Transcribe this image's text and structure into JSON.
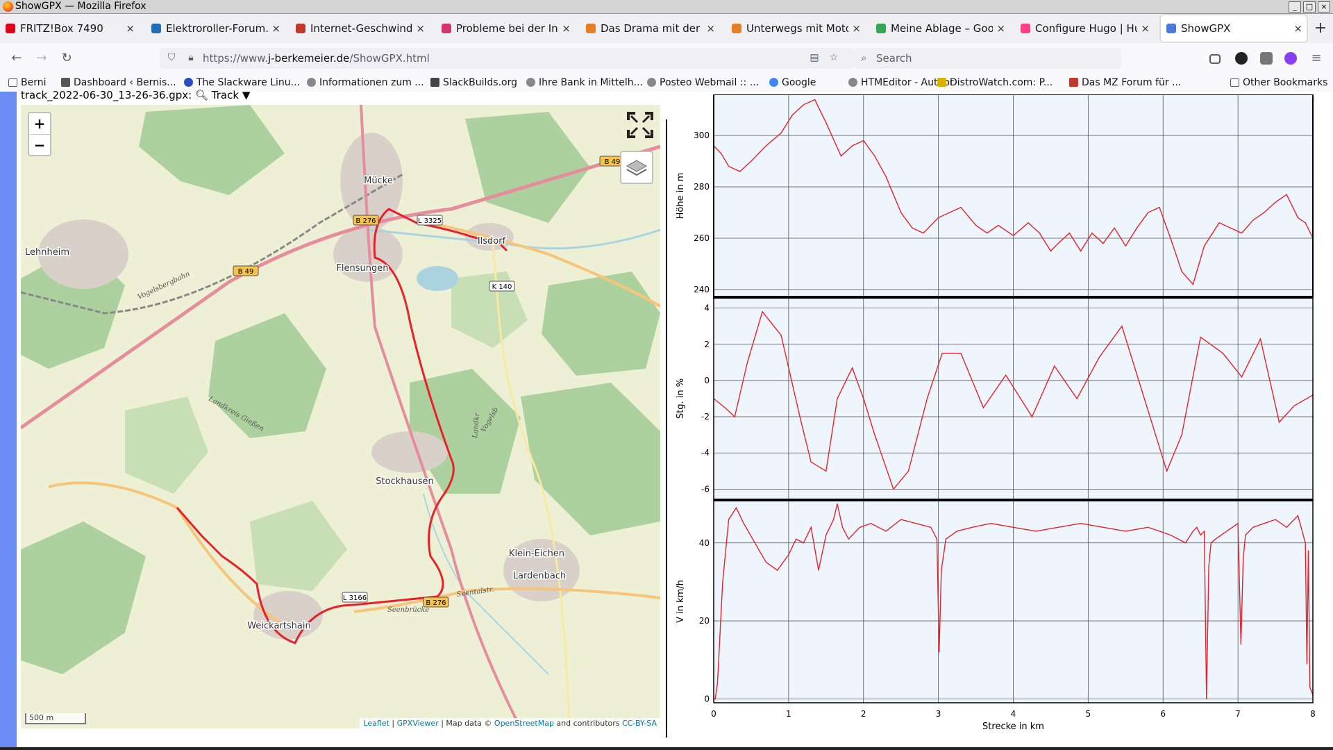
{
  "window": {
    "title": "ShowGPX — Mozilla Firefox"
  },
  "tabs": [
    {
      "label": "FRITZ!Box 7490",
      "color": "#e2001a"
    },
    {
      "label": "Elektroroller-Forum.de",
      "color": "#1e6fb8"
    },
    {
      "label": "Internet-Geschwindigk",
      "color": "#c0392b"
    },
    {
      "label": "Probleme bei der Insta",
      "color": "#d6336c"
    },
    {
      "label": "Das Drama mit der Ap",
      "color": "#e67e22"
    },
    {
      "label": "Unterwegs mit Motorr",
      "color": "#e67e22"
    },
    {
      "label": "Meine Ablage – Google",
      "color": "#34a853"
    },
    {
      "label": "Configure Hugo | Hugo",
      "color": "#ff4088"
    },
    {
      "label": "ShowGPX",
      "color": "#4a7bd9"
    }
  ],
  "nav": {
    "url_prefix": "https://www.",
    "url_domain": "j-berkemeier.de",
    "url_path": "/ShowGPX.html",
    "search_placeholder": "Search"
  },
  "bookmarks": [
    {
      "label": "Berni",
      "icon": "folder-icon"
    },
    {
      "label": "Dashboard ‹ Bernis...",
      "icon": "page-icon"
    },
    {
      "label": "The Slackware Linu...",
      "icon": "slackware-icon"
    },
    {
      "label": "Informationen zum ...",
      "icon": "globe-icon"
    },
    {
      "label": "SlackBuilds.org",
      "icon": "slackbuilds-icon"
    },
    {
      "label": "Ihre Bank in Mittelh...",
      "icon": "globe-icon"
    },
    {
      "label": "Posteo Webmail :: ...",
      "icon": "globe-icon"
    },
    {
      "label": "Google",
      "icon": "google-icon"
    },
    {
      "label": "HTMEditor - Author",
      "icon": "globe-icon"
    },
    {
      "label": "DistroWatch.com: P...",
      "icon": "distrowatch-icon"
    },
    {
      "label": "Das MZ Forum für ...",
      "icon": "mz-icon"
    },
    {
      "label": "Other Bookmarks",
      "icon": "folder-icon"
    }
  ],
  "track": {
    "file": "track_2022-06-30_13-26-36.gpx:",
    "menu_label": "Track ▼"
  },
  "map": {
    "zoom_in": "+",
    "zoom_out": "−",
    "scale": "500 m",
    "attribution": {
      "leaflet": "Leaflet",
      "sep1": " | ",
      "gpxviewer": "GPXViewer",
      "mapdata": " | Map data © ",
      "osm": "OpenStreetMap",
      "contrib": " and contributors ",
      "license": "CC-BY-SA"
    },
    "places": [
      "Mücke",
      "Lehnheim",
      "Flensungen",
      "Ilsdorf",
      "Stockhausen",
      "Klein-Eichen",
      "Lardenbach",
      "Weickartshain"
    ],
    "road_labels": [
      "B 49",
      "B 276",
      "L 3325",
      "K 140",
      "L 3166",
      "B 49",
      "B 276"
    ],
    "street_labels": [
      "Vogelsbergbahn",
      "Landkreis Gießen",
      "Seentalstr.",
      "Seenbrücke",
      "Vogelsb",
      "Landkr"
    ],
    "colors": {
      "track": "#e8202a",
      "road_primary": "#e58d9d",
      "road_secondary": "#f6c57a",
      "forest": "#add19e",
      "farmland": "#eef0d5",
      "water": "#aad3df"
    }
  },
  "chart_data": [
    {
      "type": "line",
      "ylabel": "Höhe in m",
      "ylim": [
        237,
        316
      ],
      "yticks": [
        240,
        260,
        280,
        300
      ],
      "xlim": [
        0,
        8
      ],
      "color": "#e8202a",
      "x": [
        0,
        0.1,
        0.2,
        0.35,
        0.5,
        0.7,
        0.9,
        1.05,
        1.2,
        1.35,
        1.5,
        1.7,
        1.85,
        2.0,
        2.15,
        2.3,
        2.5,
        2.65,
        2.8,
        3.0,
        3.15,
        3.3,
        3.5,
        3.65,
        3.8,
        4.0,
        4.2,
        4.35,
        4.5,
        4.6,
        4.75,
        4.9,
        5.05,
        5.2,
        5.35,
        5.5,
        5.65,
        5.8,
        5.95,
        6.1,
        6.25,
        6.4,
        6.55,
        6.75,
        6.9,
        7.05,
        7.2,
        7.35,
        7.5,
        7.65,
        7.8,
        7.9,
        8.0
      ],
      "y": [
        296,
        293,
        288,
        286,
        290,
        296,
        301,
        308,
        312,
        314,
        305,
        292,
        296,
        298,
        292,
        284,
        270,
        264,
        262,
        268,
        270,
        272,
        265,
        262,
        265,
        261,
        266,
        262,
        255,
        258,
        262,
        255,
        262,
        258,
        264,
        257,
        264,
        270,
        272,
        260,
        247,
        242,
        257,
        266,
        264,
        262,
        267,
        270,
        274,
        277,
        268,
        266,
        260
      ]
    },
    {
      "type": "line",
      "ylabel": "Stg. in %",
      "ylim": [
        -6.6,
        4.6
      ],
      "yticks": [
        -6,
        -4,
        -2,
        0,
        2,
        4
      ],
      "xlim": [
        0,
        8
      ],
      "color": "#e8202a",
      "x": [
        0,
        0.15,
        0.28,
        0.45,
        0.65,
        0.9,
        1.15,
        1.3,
        1.5,
        1.65,
        1.85,
        2.0,
        2.15,
        2.4,
        2.6,
        2.85,
        3.05,
        3.3,
        3.6,
        3.9,
        4.25,
        4.55,
        4.85,
        5.15,
        5.45,
        5.75,
        6.05,
        6.25,
        6.5,
        6.8,
        7.05,
        7.3,
        7.55,
        7.75,
        8.0
      ],
      "y": [
        -1,
        -1.5,
        -2,
        1,
        3.8,
        2.5,
        -2,
        -4.5,
        -5,
        -1,
        0.7,
        -1,
        -3,
        -6,
        -5,
        -1,
        1.5,
        1.5,
        -1.5,
        0.3,
        -2,
        0.8,
        -1,
        1.3,
        3,
        -1,
        -5,
        -3,
        2.4,
        1.5,
        0.2,
        2.3,
        -2.3,
        -1.4,
        -0.8
      ]
    },
    {
      "type": "line",
      "ylabel": "V in km/h",
      "ylim": [
        -1,
        51
      ],
      "yticks": [
        0,
        20,
        40
      ],
      "xlim": [
        0,
        8
      ],
      "color": "#e8202a",
      "x": [
        0,
        0.02,
        0.05,
        0.08,
        0.12,
        0.2,
        0.3,
        0.4,
        0.55,
        0.7,
        0.85,
        1.0,
        1.1,
        1.2,
        1.3,
        1.4,
        1.5,
        1.6,
        1.65,
        1.72,
        1.8,
        1.95,
        2.1,
        2.3,
        2.5,
        2.7,
        2.9,
        2.98,
        3.01,
        3.04,
        3.1,
        3.25,
        3.45,
        3.7,
        4.0,
        4.3,
        4.6,
        4.9,
        5.2,
        5.5,
        5.8,
        6.1,
        6.3,
        6.4,
        6.45,
        6.5,
        6.55,
        6.58,
        6.61,
        6.64,
        6.7,
        6.85,
        7.0,
        7.04,
        7.07,
        7.1,
        7.2,
        7.35,
        7.5,
        7.65,
        7.8,
        7.9,
        7.92,
        7.94,
        7.96,
        8.0
      ],
      "y": [
        0,
        0,
        4,
        15,
        30,
        46,
        49,
        45,
        40,
        35,
        33,
        37,
        41,
        40,
        44,
        33,
        42,
        46,
        50,
        44,
        41,
        44,
        45,
        43,
        46,
        45,
        44,
        41,
        12,
        33,
        41,
        43,
        44,
        45,
        44,
        43,
        44,
        45,
        44,
        43,
        44,
        42,
        40,
        43,
        44,
        42,
        43,
        0,
        34,
        40,
        41,
        43,
        45,
        14,
        36,
        42,
        44,
        45,
        46,
        44,
        47,
        40,
        9,
        38,
        3,
        1
      ]
    }
  ],
  "plot_xaxis": {
    "label": "Strecke in km",
    "ticks": [
      0,
      1,
      2,
      3,
      4,
      5,
      6,
      7,
      8
    ]
  }
}
